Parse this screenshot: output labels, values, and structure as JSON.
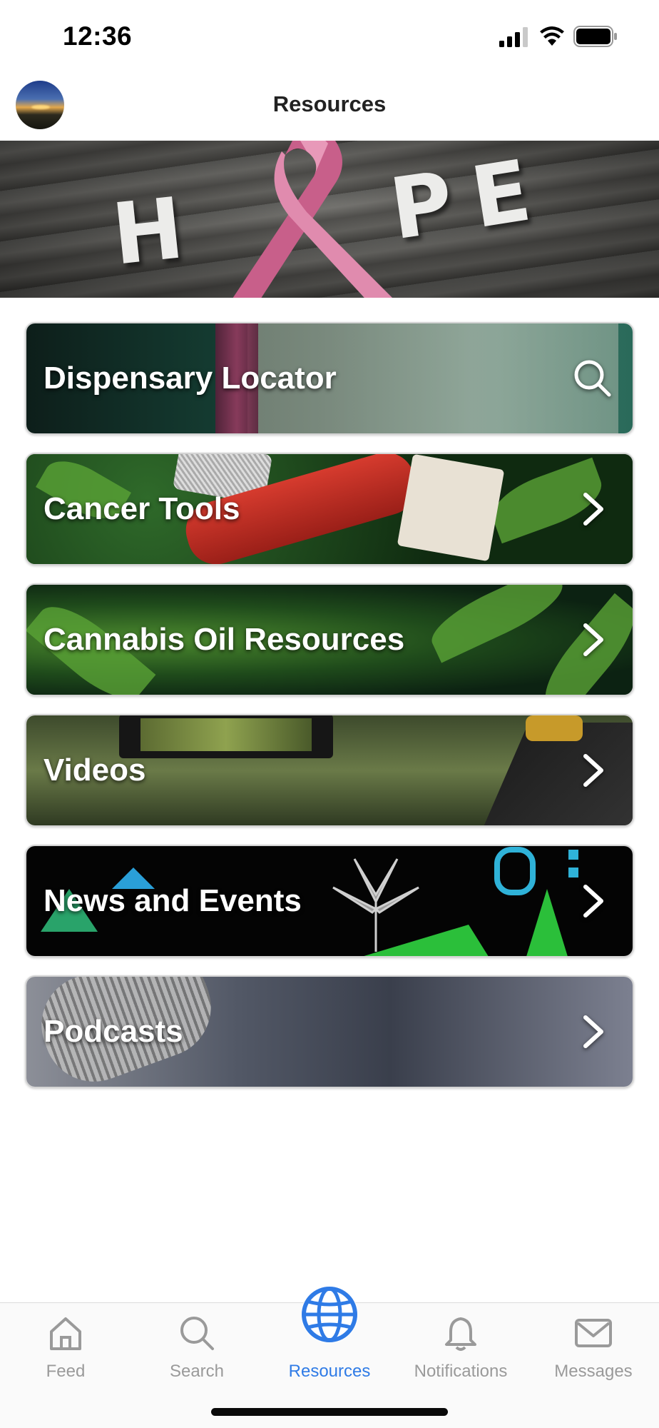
{
  "status_bar": {
    "time": "12:36"
  },
  "header": {
    "title": "Resources",
    "avatar_icon": "profile-avatar"
  },
  "hero": {
    "letters": [
      "H",
      "P",
      "E"
    ],
    "ribbon_color": "#d9789e"
  },
  "resources": [
    {
      "label": "Dispensary Locator",
      "icon": "search-icon"
    },
    {
      "label": "Cancer Tools",
      "icon": "chevron-right-icon"
    },
    {
      "label": "Cannabis Oil Resources",
      "icon": "chevron-right-icon"
    },
    {
      "label": "Videos",
      "icon": "chevron-right-icon"
    },
    {
      "label": "News and Events",
      "icon": "chevron-right-icon"
    },
    {
      "label": "Podcasts",
      "icon": "chevron-right-icon"
    }
  ],
  "tab_bar": {
    "tabs": [
      {
        "label": "Feed",
        "icon": "home-icon",
        "active": false
      },
      {
        "label": "Search",
        "icon": "search-icon",
        "active": false
      },
      {
        "label": "Resources",
        "icon": "globe-icon",
        "active": true
      },
      {
        "label": "Notifications",
        "icon": "bell-icon",
        "active": false
      },
      {
        "label": "Messages",
        "icon": "envelope-icon",
        "active": false
      }
    ],
    "active_color": "#2f7be6",
    "inactive_color": "#9a9a9a"
  }
}
